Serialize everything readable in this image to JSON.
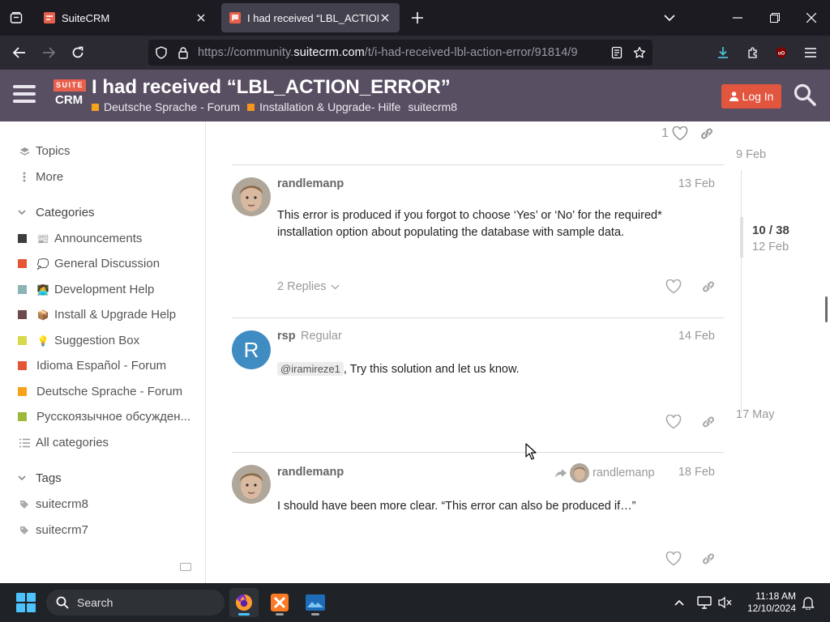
{
  "browser": {
    "tabs": [
      {
        "title": "SuiteCRM",
        "active": false
      },
      {
        "title": "I had received “LBL_ACTION_ERROR”",
        "active": true
      }
    ],
    "url_prefix": "https://community.",
    "url_domain": "suitecrm.com",
    "url_path": "/t/i-had-received-lbl-action-error/91814/9"
  },
  "site": {
    "logo_top": "SUITE",
    "logo_bottom": "CRM",
    "topic_title": "I had received “LBL_ACTION_ERROR”",
    "breadcrumbs": [
      {
        "label": "Deutsche Sprache - Forum",
        "color": "#f7a21b"
      },
      {
        "label": "Installation & Upgrade- Hilfe",
        "color": "#f7941d"
      },
      {
        "label": "suitecrm8",
        "color": ""
      }
    ],
    "login_label": "Log In"
  },
  "sidebar": {
    "topics": "Topics",
    "more": "More",
    "categories_header": "Categories",
    "categories": [
      {
        "label": "Announcements",
        "color": "#3d3d3d",
        "emoji": "📰"
      },
      {
        "label": "General Discussion",
        "color": "#e45735",
        "emoji": "💭"
      },
      {
        "label": "Development Help",
        "color": "#8cb3b5",
        "emoji": "👩‍💻"
      },
      {
        "label": "Install & Upgrade Help",
        "color": "#6f4a4a",
        "emoji": "📦"
      },
      {
        "label": "Suggestion Box",
        "color": "#d8d84a",
        "emoji": "💡"
      },
      {
        "label": "Idioma Español - Forum",
        "color": "#e45735",
        "emoji": ""
      },
      {
        "label": "Deutsche Sprache - Forum",
        "color": "#f7a21b",
        "emoji": ""
      },
      {
        "label": "Русскоязычное обсужден...",
        "color": "#9eb83b",
        "emoji": ""
      }
    ],
    "all_categories": "All categories",
    "tags_header": "Tags",
    "tags": [
      "suitecrm8",
      "suitecrm7"
    ]
  },
  "posts": {
    "previous_like_count": "1",
    "items": [
      {
        "username": "randlemanp",
        "user_title": "",
        "date": "13 Feb",
        "body": "This error is produced if you forgot to choose ‘Yes’ or ‘No’ for the required* installation option about populating the database with sample data.",
        "replies": "2 Replies"
      },
      {
        "username": "rsp",
        "user_title": "Regular",
        "avatar_letter": "R",
        "date": "14 Feb",
        "mention": "@iramireze1",
        "body": ", Try this solution and let us know."
      },
      {
        "username": "randlemanp",
        "date": "18 Feb",
        "reply_to": "randlemanp",
        "body": "I should have been more clear. “This error can also be produced if…”"
      }
    ]
  },
  "timeline": {
    "top_date": "9 Feb",
    "position": "10 / 38",
    "position_date": "12 Feb",
    "bottom_date": "17 May"
  },
  "taskbar": {
    "search_label": "Search",
    "time": "11:18 AM",
    "date": "12/10/2024"
  },
  "colors": {
    "header_bg": "#594f63",
    "accent": "#e2553f",
    "avatar_r": "#3e8cc2"
  }
}
